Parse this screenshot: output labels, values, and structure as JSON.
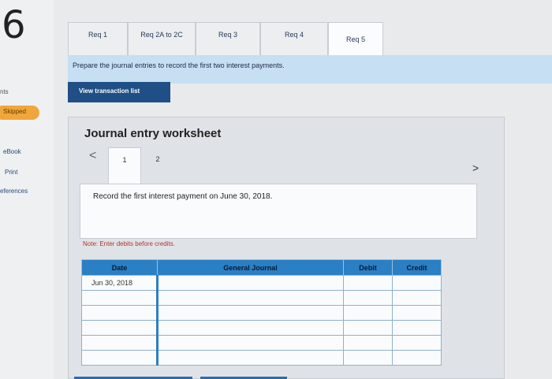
{
  "question_number": "6",
  "rail": {
    "label_points": "nts",
    "skipped": "Skipped",
    "ebook": "eBook",
    "print": "Print",
    "references": "eferences"
  },
  "tabs": [
    "Req 1",
    "Req 2A to 2C",
    "Req 3",
    "Req 4",
    "Req 5"
  ],
  "active_tab": "Req 5",
  "instruction": "Prepare the journal entries to record the first two interest payments.",
  "view_button": "View transaction list",
  "worksheet": {
    "title": "Journal entry worksheet",
    "nav_prev": "<",
    "nav_next": ">",
    "pages": [
      "1",
      "2"
    ],
    "active_page": "1",
    "entry_text": "Record the first interest payment on June 30, 2018.",
    "note": "Note: Enter debits before credits.",
    "table": {
      "headers": {
        "date": "Date",
        "general_journal": "General Journal",
        "debit": "Debit",
        "credit": "Credit"
      },
      "rows": [
        {
          "date": "Jun 30, 2018",
          "account": "",
          "debit": "",
          "credit": ""
        },
        {
          "date": "",
          "account": "",
          "debit": "",
          "credit": ""
        },
        {
          "date": "",
          "account": "",
          "debit": "",
          "credit": ""
        },
        {
          "date": "",
          "account": "",
          "debit": "",
          "credit": ""
        },
        {
          "date": "",
          "account": "",
          "debit": "",
          "credit": ""
        },
        {
          "date": "",
          "account": "",
          "debit": "",
          "credit": ""
        }
      ]
    }
  },
  "colors": {
    "header_blue": "#2b7fc4",
    "button_navy": "#1f4f86",
    "instruction_bg": "#c6dff2",
    "skipped_orange": "#f0a63a"
  }
}
